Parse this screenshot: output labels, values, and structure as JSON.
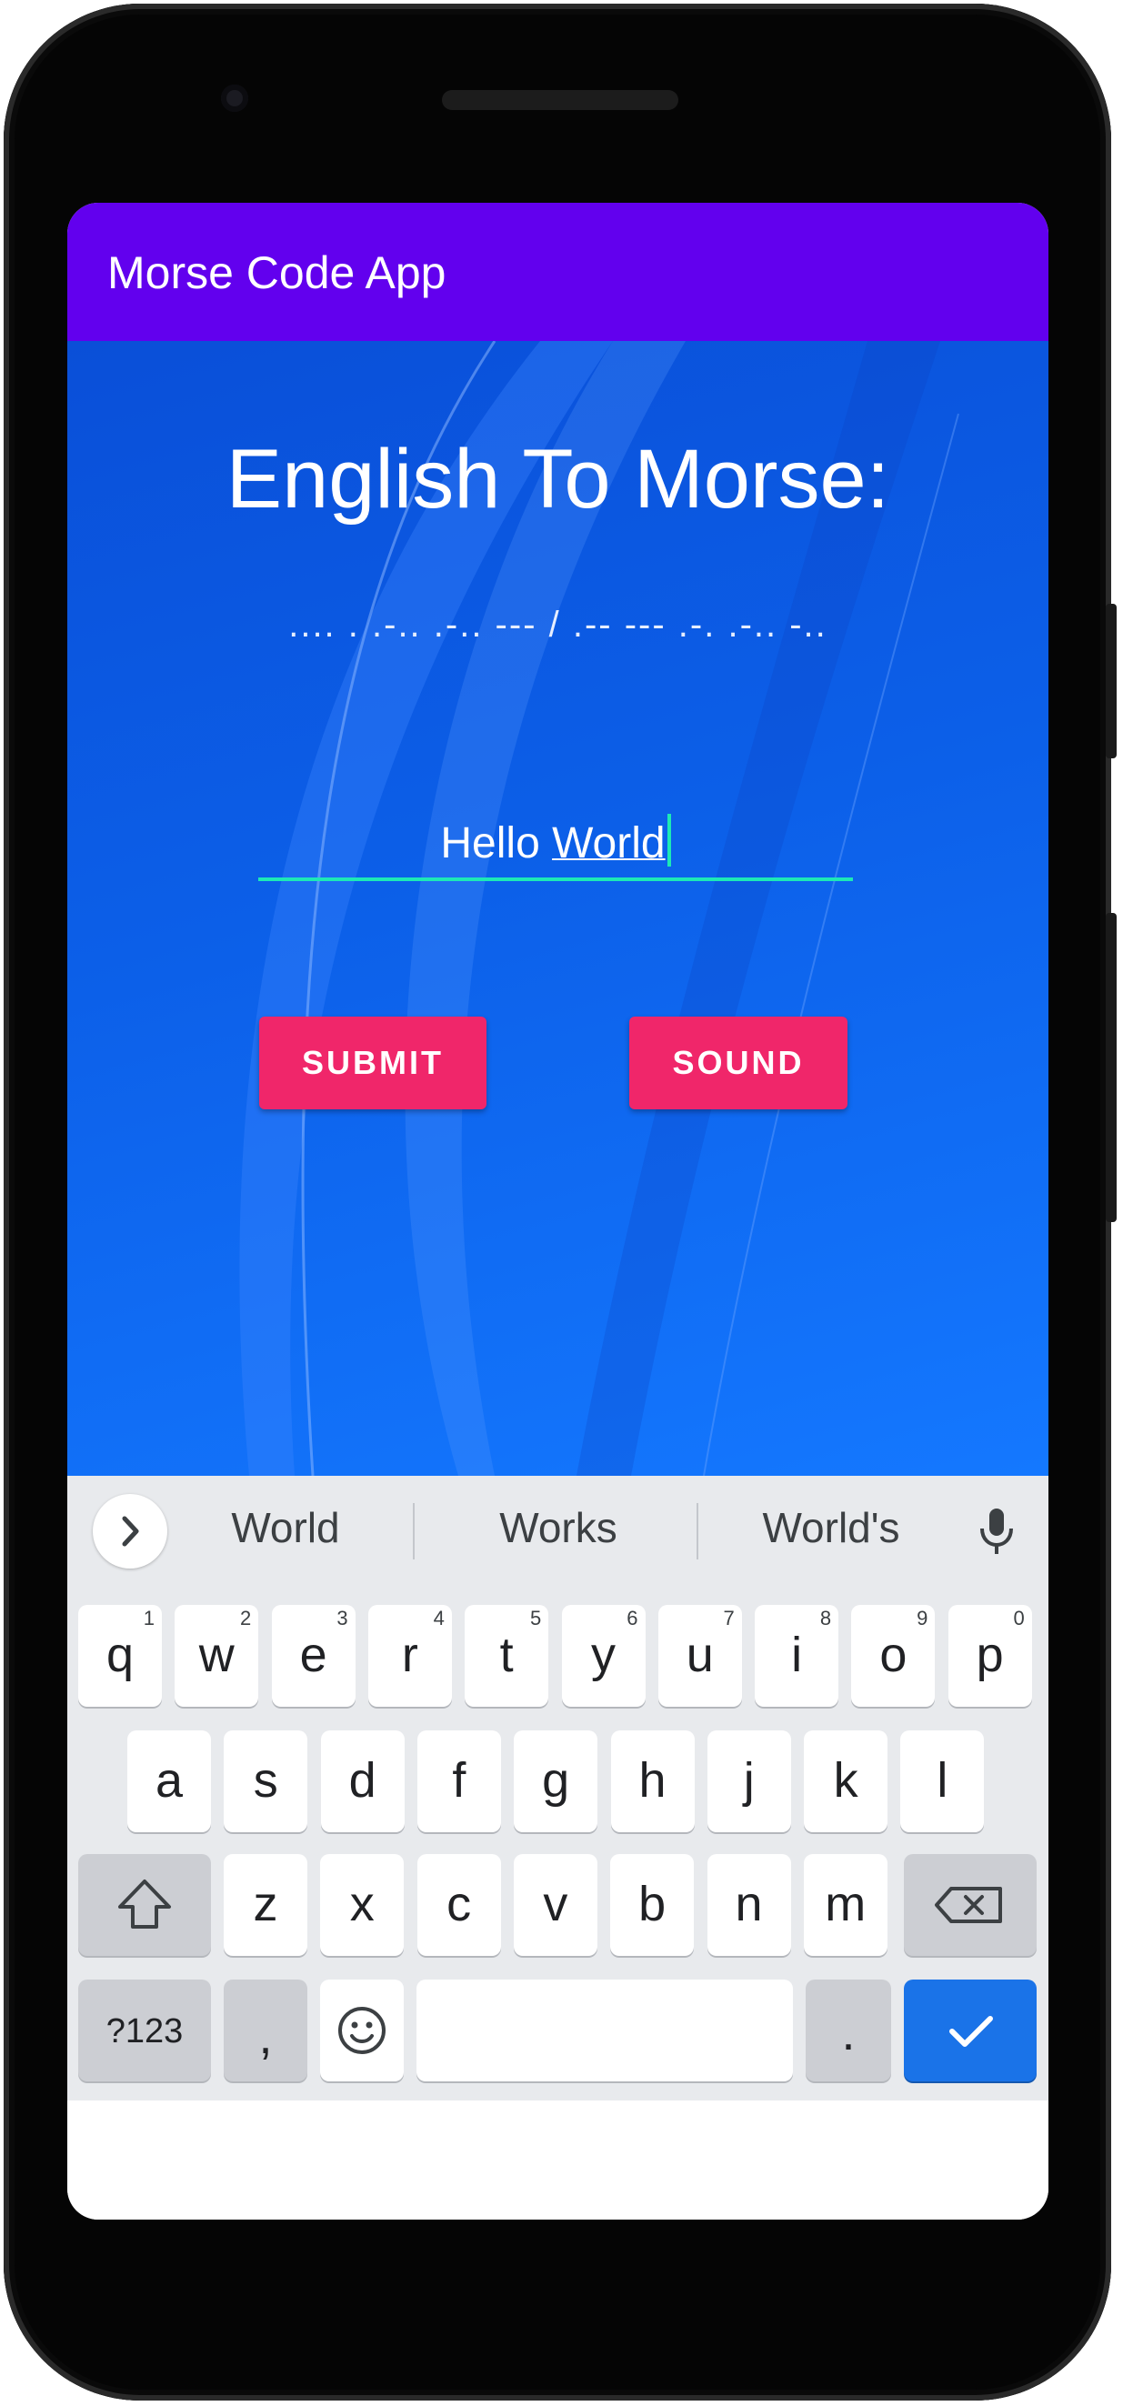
{
  "app": {
    "title": "Morse Code App"
  },
  "main": {
    "heading": "English To Morse:",
    "morse_output": ".... . .-.. .-.. --- / .-- --- .-. .-.. -..",
    "input": {
      "plain": "Hello ",
      "underlined": "World"
    },
    "submit_label": "SUBMIT",
    "sound_label": "SOUND"
  },
  "keyboard": {
    "suggestions": [
      "World",
      "Works",
      "World's"
    ],
    "row1": [
      {
        "k": "q",
        "n": "1"
      },
      {
        "k": "w",
        "n": "2"
      },
      {
        "k": "e",
        "n": "3"
      },
      {
        "k": "r",
        "n": "4"
      },
      {
        "k": "t",
        "n": "5"
      },
      {
        "k": "y",
        "n": "6"
      },
      {
        "k": "u",
        "n": "7"
      },
      {
        "k": "i",
        "n": "8"
      },
      {
        "k": "o",
        "n": "9"
      },
      {
        "k": "p",
        "n": "0"
      }
    ],
    "row2": [
      "a",
      "s",
      "d",
      "f",
      "g",
      "h",
      "j",
      "k",
      "l"
    ],
    "row3": [
      "z",
      "x",
      "c",
      "v",
      "b",
      "n",
      "m"
    ],
    "symbols_label": "?123",
    "comma_label": ",",
    "period_label": ".",
    "accent_color": "#1a73e8"
  },
  "colors": {
    "appbar": "#6200ee",
    "button": "#f0266a",
    "underline": "#1de9b6"
  }
}
